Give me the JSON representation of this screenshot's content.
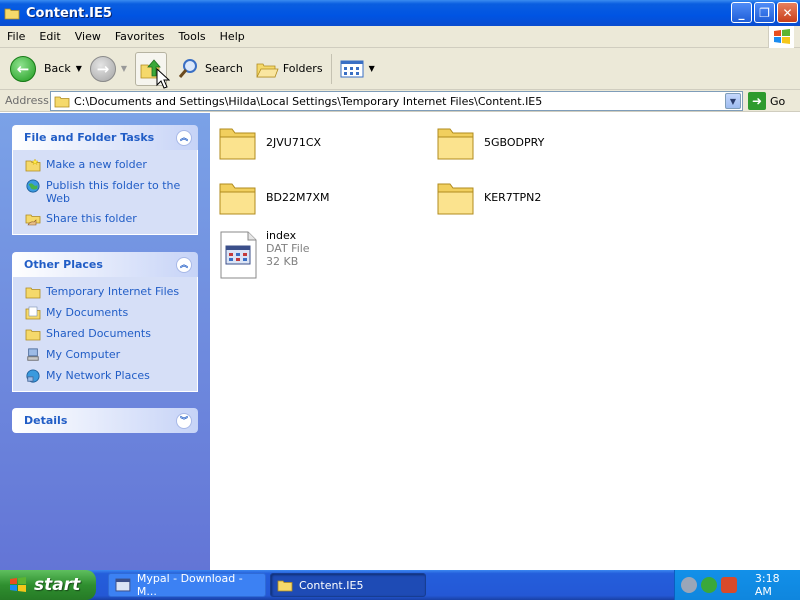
{
  "window": {
    "title": "Content.IE5",
    "controls": {
      "minimize": "_",
      "maximize": "❐",
      "close": "✕"
    }
  },
  "menu": [
    "File",
    "Edit",
    "View",
    "Favorites",
    "Tools",
    "Help"
  ],
  "toolbar": {
    "back_label": "Back",
    "search_label": "Search",
    "folders_label": "Folders"
  },
  "address": {
    "label": "Address",
    "value": "C:\\Documents and Settings\\Hilda\\Local Settings\\Temporary Internet Files\\Content.IE5",
    "go_label": "Go"
  },
  "tasks_panel": {
    "title": "File and Folder Tasks",
    "items": [
      {
        "label": "Make a new folder",
        "icon": "new-folder-icon"
      },
      {
        "label": "Publish this folder to the Web",
        "icon": "publish-web-icon"
      },
      {
        "label": "Share this folder",
        "icon": "share-folder-icon"
      }
    ]
  },
  "places_panel": {
    "title": "Other Places",
    "items": [
      {
        "label": "Temporary Internet Files",
        "icon": "folder-icon"
      },
      {
        "label": "My Documents",
        "icon": "my-documents-icon"
      },
      {
        "label": "Shared Documents",
        "icon": "folder-icon"
      },
      {
        "label": "My Computer",
        "icon": "my-computer-icon"
      },
      {
        "label": "My Network Places",
        "icon": "network-places-icon"
      }
    ]
  },
  "details_panel": {
    "title": "Details"
  },
  "files": [
    {
      "name": "2JVU71CX",
      "type": "folder"
    },
    {
      "name": "5GBODPRY",
      "type": "folder"
    },
    {
      "name": "BD22M7XM",
      "type": "folder"
    },
    {
      "name": "KER7TPN2",
      "type": "folder"
    },
    {
      "name": "index",
      "type": "file",
      "kind": "DAT File",
      "size": "32 KB"
    }
  ],
  "taskbar": {
    "start_label": "start",
    "buttons": [
      {
        "label": "Mypal - Download - M...",
        "active": false
      },
      {
        "label": "Content.IE5",
        "active": true
      }
    ],
    "clock": "3:18 AM"
  },
  "colors": {
    "title_blue": "#0054e3",
    "pane_blue": "#6375d6",
    "link_blue": "#215dc6",
    "start_green": "#2f8f2f"
  }
}
